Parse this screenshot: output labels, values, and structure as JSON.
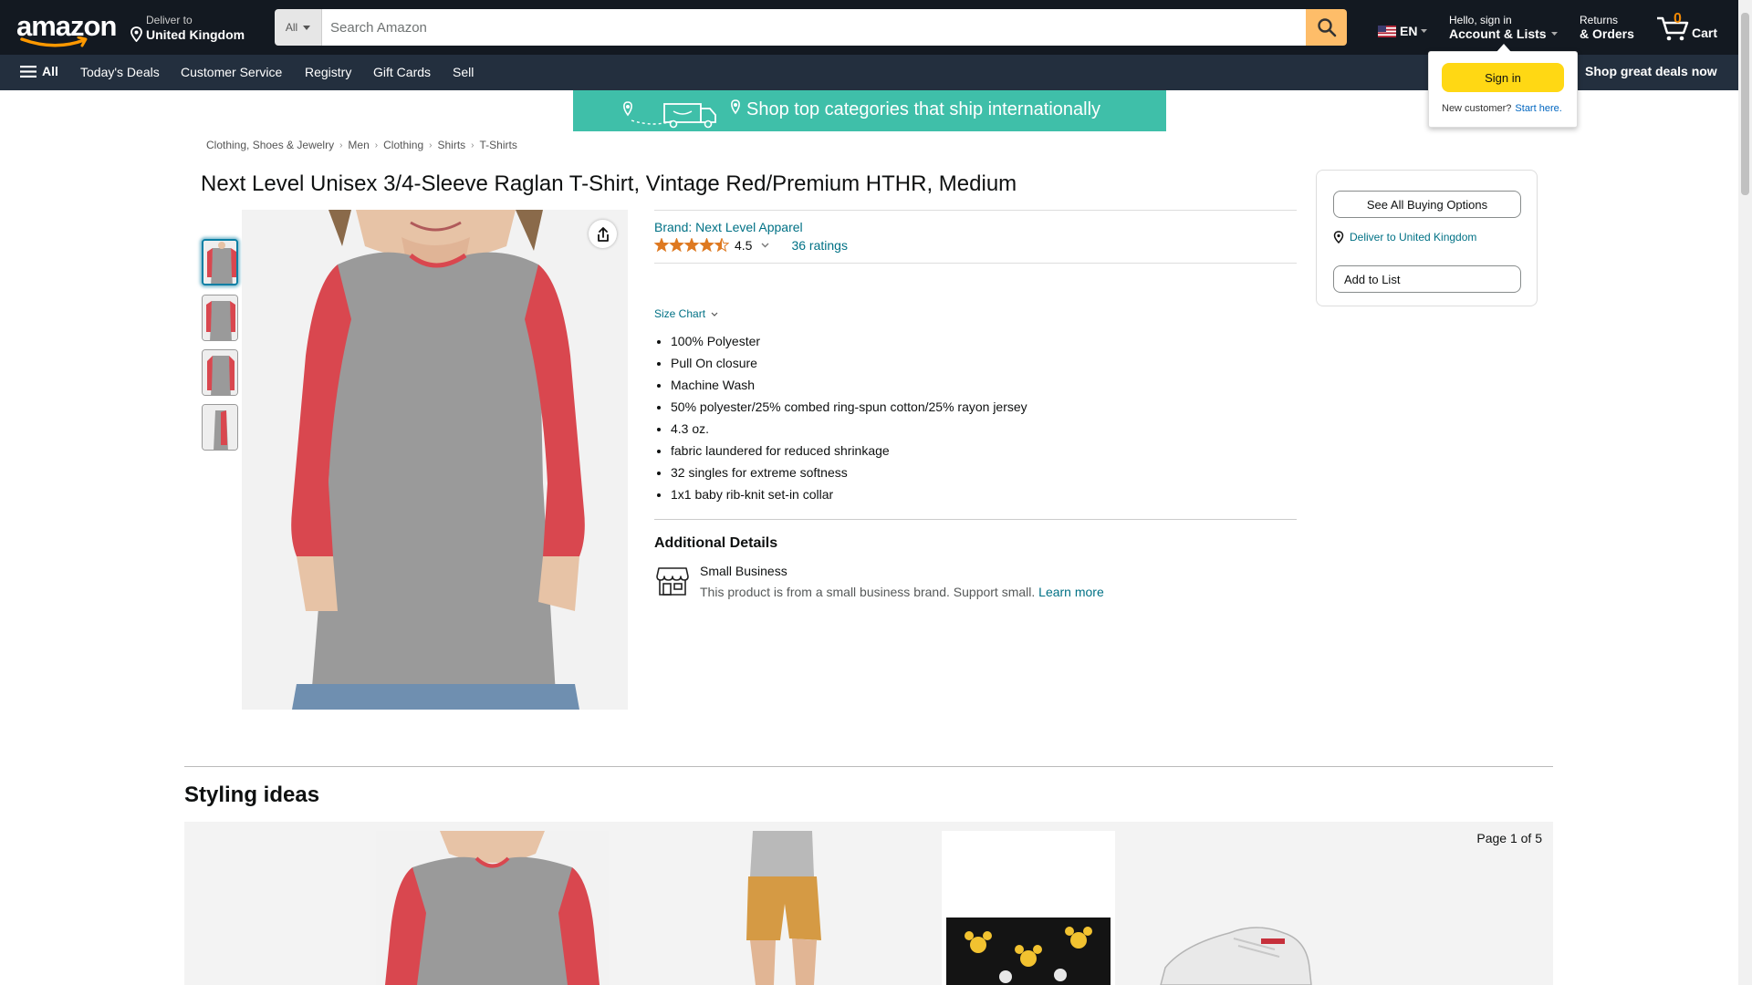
{
  "header": {
    "logo_text": "amazon",
    "deliver_line1": "Deliver to",
    "deliver_line2": "United Kingdom",
    "search_category": "All",
    "search_placeholder": "Search Amazon",
    "language": "EN",
    "account_line1": "Hello, sign in",
    "account_line2": "Account & Lists",
    "returns_line1": "Returns",
    "returns_line2": "& Orders",
    "cart_count": "0",
    "cart_label": "Cart"
  },
  "subnav": {
    "all_label": "All",
    "items": [
      "Today's Deals",
      "Customer Service",
      "Registry",
      "Gift Cards",
      "Sell"
    ],
    "right_promo": "Shop great deals now"
  },
  "flyout": {
    "signin_label": "Sign in",
    "new_customer": "New customer?",
    "start_here": "Start here."
  },
  "banner": {
    "text": "Shop top categories that ship internationally"
  },
  "breadcrumb": [
    "Clothing, Shoes & Jewelry",
    "Men",
    "Clothing",
    "Shirts",
    "T-Shirts"
  ],
  "product": {
    "title": "Next Level Unisex 3/4-Sleeve Raglan T-Shirt, Vintage Red/Premium HTHR, Medium",
    "brand_link": "Brand: Next Level Apparel",
    "rating_value": "4.5",
    "rating_stars": 4.5,
    "ratings_count": "36 ratings",
    "size_chart": "Size Chart",
    "bullets": [
      "100% Polyester",
      "Pull On closure",
      "Machine Wash",
      "50% polyester/25% combed ring-spun cotton/25% rayon jersey",
      "4.3 oz.",
      "fabric laundered for reduced shrinkage",
      "32 singles for extreme softness",
      "1x1 baby rib-knit set-in collar"
    ],
    "additional_details_title": "Additional Details",
    "small_business_title": "Small Business",
    "small_business_desc": "This product is from a small business brand. Support small.",
    "learn_more": "Learn more"
  },
  "buybox": {
    "see_all_buying_options": "See All Buying Options",
    "deliver_to": "Deliver to United Kingdom",
    "add_to_list": "Add to List"
  },
  "styling": {
    "title": "Styling ideas",
    "pager": "Page 1 of 5"
  },
  "colors": {
    "nav_dark": "#131921",
    "nav_sub": "#232f3e",
    "search_button": "#febd69",
    "signin_button": "#ffd814",
    "link": "#007185",
    "star": "#de7921",
    "shirt_red": "#d9474f",
    "shirt_gray": "#9a9a9a"
  }
}
